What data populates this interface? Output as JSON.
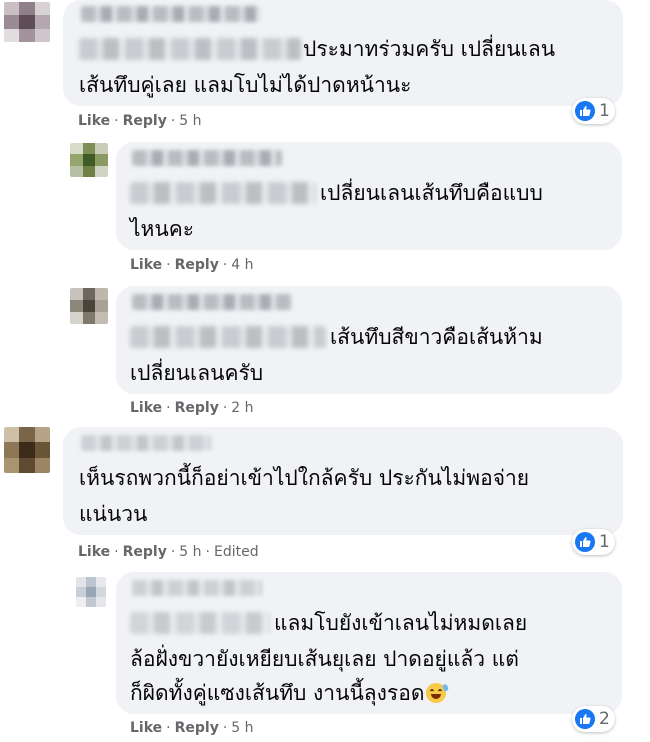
{
  "comments": [
    {
      "text_lines": [
        "ประมาทร่วมครับ เปลี่ยนเลน",
        "เส้นทึบคู่เลย แลมโบไม่ได้ปาดหน้านะ"
      ],
      "actions": {
        "like": "Like",
        "reply": "Reply",
        "time": "5 h"
      },
      "reaction": {
        "icon": "like-icon",
        "count": "1"
      }
    },
    {
      "text_lines": [
        "เปลี่ยนเลนเส้นทึบคือแบบ",
        "ไหนคะ"
      ],
      "actions": {
        "like": "Like",
        "reply": "Reply",
        "time": "4 h"
      }
    },
    {
      "text_lines": [
        "เส้นทึบสีขาวคือเส้นห้าม",
        "เปลี่ยนเลนครับ"
      ],
      "actions": {
        "like": "Like",
        "reply": "Reply",
        "time": "2 h"
      }
    },
    {
      "text_lines": [
        "เห็นรถพวกนี้ก็อย่าเข้าไปใกล้ครับ ประกันไม่พอจ่าย",
        "แน่นวน"
      ],
      "actions": {
        "like": "Like",
        "reply": "Reply",
        "time": "5 h",
        "edited": "Edited"
      },
      "reaction": {
        "icon": "like-icon",
        "count": "1"
      }
    },
    {
      "text_lines": [
        "แลมโบยังเข้าเลนไม่หมดเลย",
        "ล้อฝั่งขวายังเหยียบเส้นยุเลย ปาดอยู่แล้ว แต่",
        "ก็ผิดทั้งคู่แซงเส้นทึบ งานนี้ลุงรอด"
      ],
      "emoji": "sweat-smile-emoji",
      "actions": {
        "like": "Like",
        "reply": "Reply",
        "time": "5 h"
      },
      "reaction": {
        "icon": "like-icon",
        "count": "2"
      }
    }
  ],
  "colors": {
    "bubble": "#f0f2f5",
    "meta": "#65676b",
    "like_blue": "#1877f2"
  }
}
